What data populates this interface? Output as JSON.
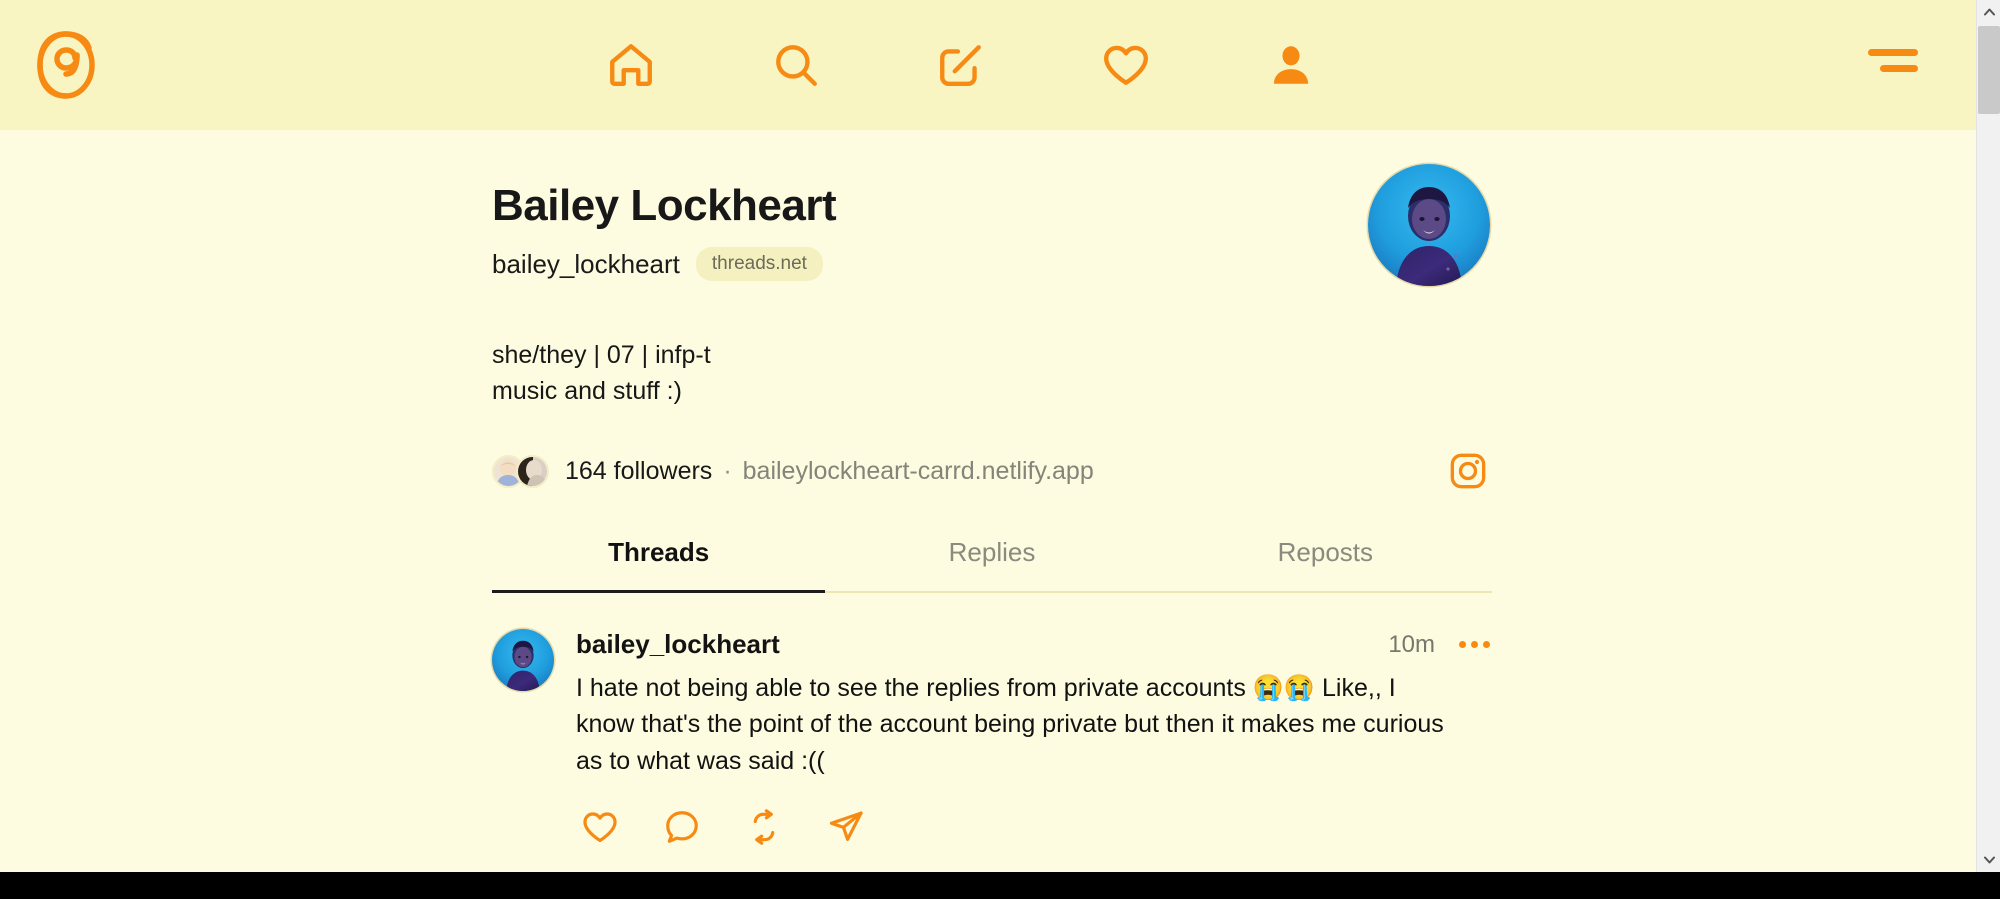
{
  "theme": {
    "nav_bg": "#f9f5c2",
    "page_bg": "#fdfbe0",
    "accent": "#f68a13",
    "text": "#181818",
    "muted": "#84847a"
  },
  "topnav": {
    "logo_label": "Threads",
    "items": [
      {
        "name": "home",
        "label": "Home",
        "active": false
      },
      {
        "name": "search",
        "label": "Search",
        "active": false
      },
      {
        "name": "create",
        "label": "Create",
        "active": false
      },
      {
        "name": "activity",
        "label": "Activity",
        "active": false
      },
      {
        "name": "profile",
        "label": "Profile",
        "active": true
      }
    ],
    "menu_label": "More"
  },
  "profile": {
    "display_name": "Bailey Lockheart",
    "handle": "bailey_lockheart",
    "domain_badge": "threads.net",
    "bio_line1": "she/they | 07 | infp-t",
    "bio_line2": "music and stuff :)",
    "followers": "164 followers",
    "separator": "·",
    "website": "baileylockheart-carrd.netlify.app",
    "instagram_label": "Instagram"
  },
  "tabs": [
    {
      "label": "Threads",
      "active": true
    },
    {
      "label": "Replies",
      "active": false
    },
    {
      "label": "Reposts",
      "active": false
    }
  ],
  "posts": [
    {
      "username": "bailey_lockheart",
      "time": "10m",
      "text_before": "I hate not being able to see the replies from private accounts ",
      "emoji": "😭😭",
      "text_after": " Like,, I know that's the point of the account being private but then it makes me curious as to what was said :((",
      "actions": [
        {
          "name": "like",
          "label": "Like"
        },
        {
          "name": "reply",
          "label": "Reply"
        },
        {
          "name": "repost",
          "label": "Repost"
        },
        {
          "name": "share",
          "label": "Share"
        }
      ],
      "more_label": "More options"
    }
  ]
}
